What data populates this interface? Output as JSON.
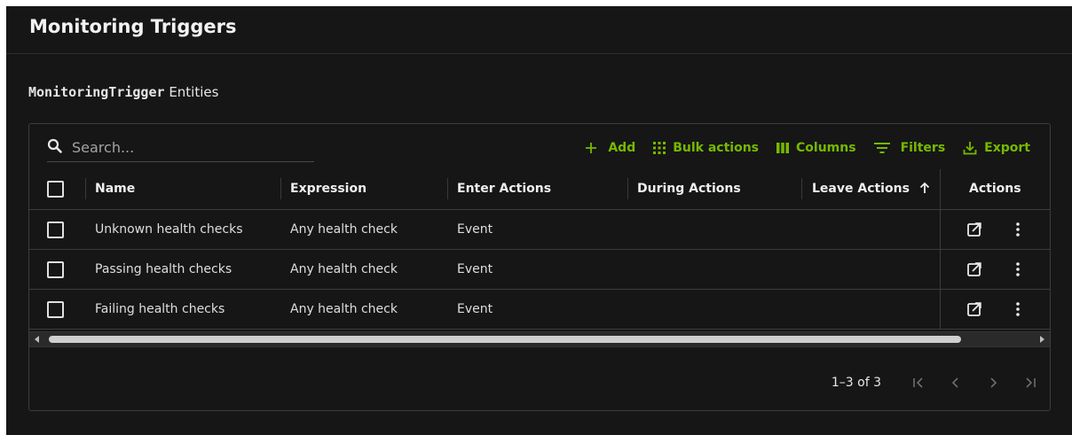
{
  "header": {
    "title": "Monitoring Triggers"
  },
  "section": {
    "entity_type": "MonitoringTrigger",
    "suffix": "Entities"
  },
  "search": {
    "placeholder": "Search..."
  },
  "toolbar": {
    "add": "Add",
    "bulk_actions": "Bulk actions",
    "columns": "Columns",
    "filters": "Filters",
    "export": "Export"
  },
  "table": {
    "columns": {
      "name": "Name",
      "expression": "Expression",
      "enter_actions": "Enter Actions",
      "during_actions": "During Actions",
      "leave_actions": "Leave Actions",
      "actions": "Actions"
    },
    "sort": {
      "column": "Leave Actions",
      "direction": "ascending"
    },
    "rows": [
      {
        "name": "Unknown health checks",
        "expression": "Any health check",
        "enter_actions": "Event",
        "during_actions": "",
        "leave_actions": ""
      },
      {
        "name": "Passing health checks",
        "expression": "Any health check",
        "enter_actions": "Event",
        "during_actions": "",
        "leave_actions": ""
      },
      {
        "name": "Failing health checks",
        "expression": "Any health check",
        "enter_actions": "Event",
        "during_actions": "",
        "leave_actions": ""
      }
    ]
  },
  "pagination": {
    "range_text": "1–3 of 3"
  },
  "icons": {
    "search": "search-icon",
    "add": "plus-icon",
    "bulk_actions": "grid-dots-icon",
    "columns": "columns-icon",
    "filters": "filter-icon",
    "export": "download-icon",
    "row_open": "open-external-icon",
    "row_more": "more-vertical-icon",
    "sort": "arrow-up-icon"
  },
  "colors": {
    "accent": "#76b900",
    "background": "#161616",
    "border": "#3d3d3d",
    "text": "#e8e8e8"
  }
}
